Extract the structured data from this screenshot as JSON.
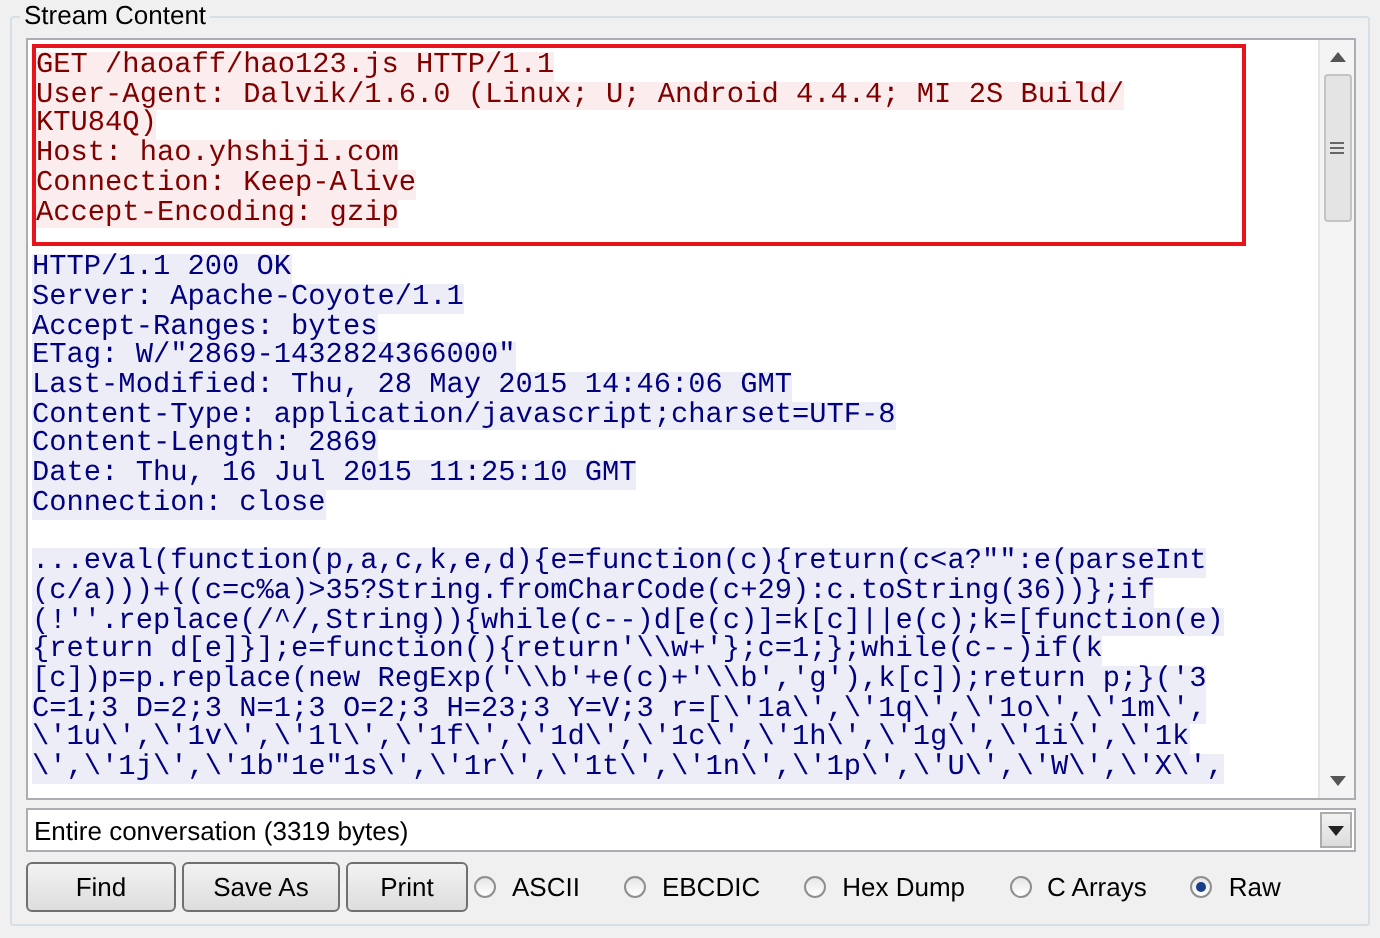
{
  "panel": {
    "title": "Stream Content"
  },
  "stream": {
    "blocks": [
      {
        "kind": "request",
        "boxed": true,
        "lines": [
          "GET /haoaff/hao123.js HTTP/1.1",
          "User-Agent: Dalvik/1.6.0 (Linux; U; Android 4.4.4; MI 2S Build/",
          "KTU84Q)",
          "Host: hao.yhshiji.com",
          "Connection: Keep-Alive",
          "Accept-Encoding: gzip"
        ]
      },
      {
        "kind": "response",
        "boxed": false,
        "lines": [
          "HTTP/1.1 200 OK",
          "Server: Apache-Coyote/1.1",
          "Accept-Ranges: bytes",
          "ETag: W/\"2869-1432824366000\"",
          "Last-Modified: Thu, 28 May 2015 14:46:06 GMT",
          "Content-Type: application/javascript;charset=UTF-8",
          "Content-Length: 2869",
          "Date: Thu, 16 Jul 2015 11:25:10 GMT",
          "Connection: close"
        ]
      },
      {
        "kind": "response",
        "boxed": false,
        "lines": [
          "...eval(function(p,a,c,k,e,d){e=function(c){return(c<a?\"\":e(parseInt",
          "(c/a)))+((c=c%a)>35?String.fromCharCode(c+29):c.toString(36))};if",
          "(!''.replace(/^/,String)){while(c--)d[e(c)]=k[c]||e(c);k=[function(e)",
          "{return d[e]}];e=function(){return'\\\\w+'};c=1;};while(c--)if(k",
          "[c])p=p.replace(new RegExp('\\\\b'+e(c)+'\\\\b','g'),k[c]);return p;}('3",
          "C=1;3 D=2;3 N=1;3 O=2;3 H=23;3 Y=V;3 r=[\\'1a\\',\\'1q\\',\\'1o\\',\\'1m\\',",
          "\\'1u\\',\\'1v\\',\\'1l\\',\\'1f\\',\\'1d\\',\\'1c\\',\\'1h\\',\\'1g\\',\\'1i\\',\\'1k",
          "\\',\\'1j\\',\\'1b\"1e\"1s\\',\\'1r\\',\\'1t\\',\\'1n\\',\\'1p\\',\\'U\\',\\'W\\',\\'X\\',"
        ]
      }
    ]
  },
  "conversation_select": {
    "value": "Entire conversation (3319 bytes)"
  },
  "buttons": [
    "Find",
    "Save As",
    "Print"
  ],
  "formats": [
    {
      "label": "ASCII",
      "selected": false
    },
    {
      "label": "EBCDIC",
      "selected": false
    },
    {
      "label": "Hex Dump",
      "selected": false
    },
    {
      "label": "C Arrays",
      "selected": false
    },
    {
      "label": "Raw",
      "selected": true
    }
  ]
}
